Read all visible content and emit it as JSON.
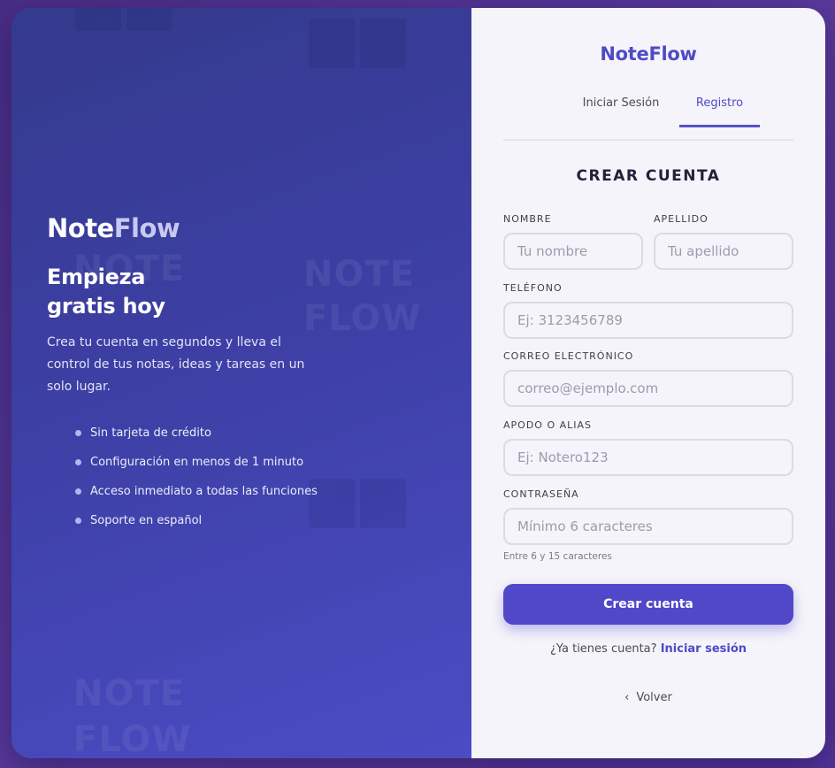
{
  "left": {
    "brand_part1": "Note",
    "brand_part2": "Flow",
    "headline_line1": "Empieza",
    "headline_line2": "gratis hoy",
    "description": "Crea tu cuenta en segundos y lleva el control de tus notas, ideas y tareas en un solo lugar.",
    "bullets": [
      "Sin tarjeta de crédito",
      "Configuración en menos de 1 minuto",
      "Acceso inmediato a todas las funciones",
      "Soporte en español"
    ],
    "decor_word_1": "NOTE",
    "decor_word_2": "FLOW"
  },
  "right": {
    "brand": "NoteFlow",
    "tabs": [
      {
        "label": "Iniciar Sesión",
        "active": false
      },
      {
        "label": "Registro",
        "active": true
      }
    ],
    "title": "CREAR CUENTA",
    "fields": {
      "nombre": {
        "label": "NOMBRE",
        "placeholder": "Tu nombre",
        "value": ""
      },
      "apellido": {
        "label": "APELLIDO",
        "placeholder": "Tu apellido",
        "value": ""
      },
      "telefono": {
        "label": "TELÉFONO",
        "placeholder": "Ej: 3123456789",
        "value": ""
      },
      "correo": {
        "label": "CORREO ELECTRÓNICO",
        "placeholder": "correo@ejemplo.com",
        "value": ""
      },
      "apodo": {
        "label": "APODO O ALIAS",
        "placeholder": "Ej: Notero123",
        "value": ""
      },
      "contrasena": {
        "label": "CONTRASEÑA",
        "placeholder": "Mínimo 6 caracteres",
        "value": "",
        "hint": "Entre 6 y 15 caracteres"
      }
    },
    "submit_label": "Crear cuenta",
    "login_prompt": "¿Ya tienes cuenta?",
    "login_link": "Iniciar sesión",
    "back_label": "Volver"
  },
  "colors": {
    "accent": "#5048c9",
    "brand": "#4f4bc6",
    "left_panel_start": "#343a8c",
    "left_panel_end": "#4b4cc4"
  },
  "icons": {
    "back": "chevron-left-icon",
    "decor": "open-book-icon"
  }
}
